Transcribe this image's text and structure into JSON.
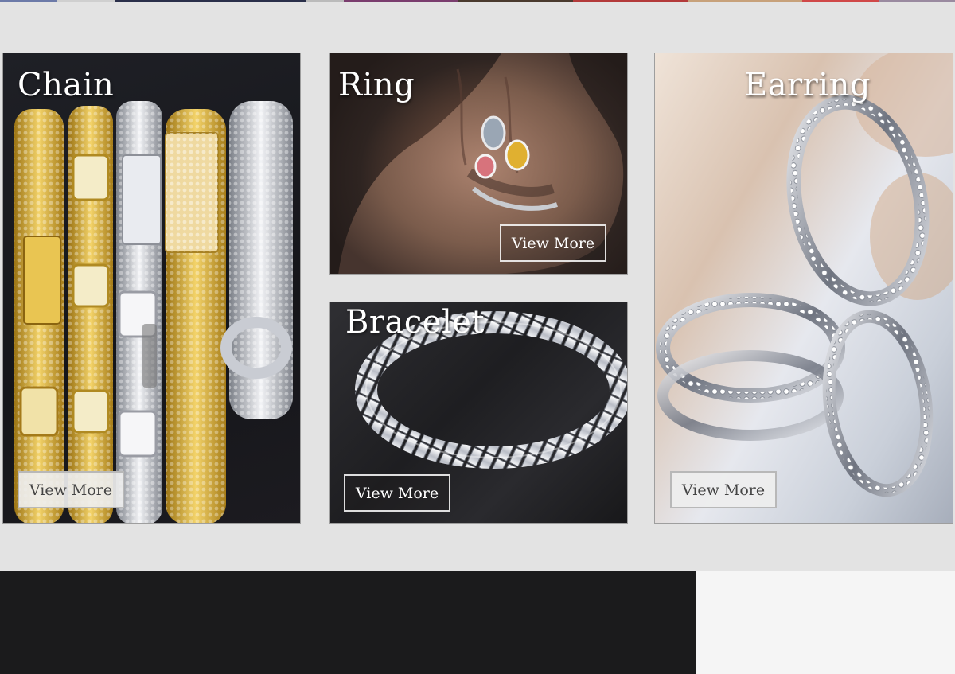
{
  "categories": [
    {
      "id": "chain",
      "title": "Chain",
      "button": "View More"
    },
    {
      "id": "ring",
      "title": "Ring",
      "button": "View More"
    },
    {
      "id": "bracelet",
      "title": "Bracelet",
      "button": "View More"
    },
    {
      "id": "earring",
      "title": "Earring",
      "button": "View More"
    }
  ],
  "colors": {
    "page_background": "#e3e3e3",
    "title_text": "#ffffff",
    "footer_dark": "#1b1b1c",
    "footer_light": "#f5f5f5"
  }
}
